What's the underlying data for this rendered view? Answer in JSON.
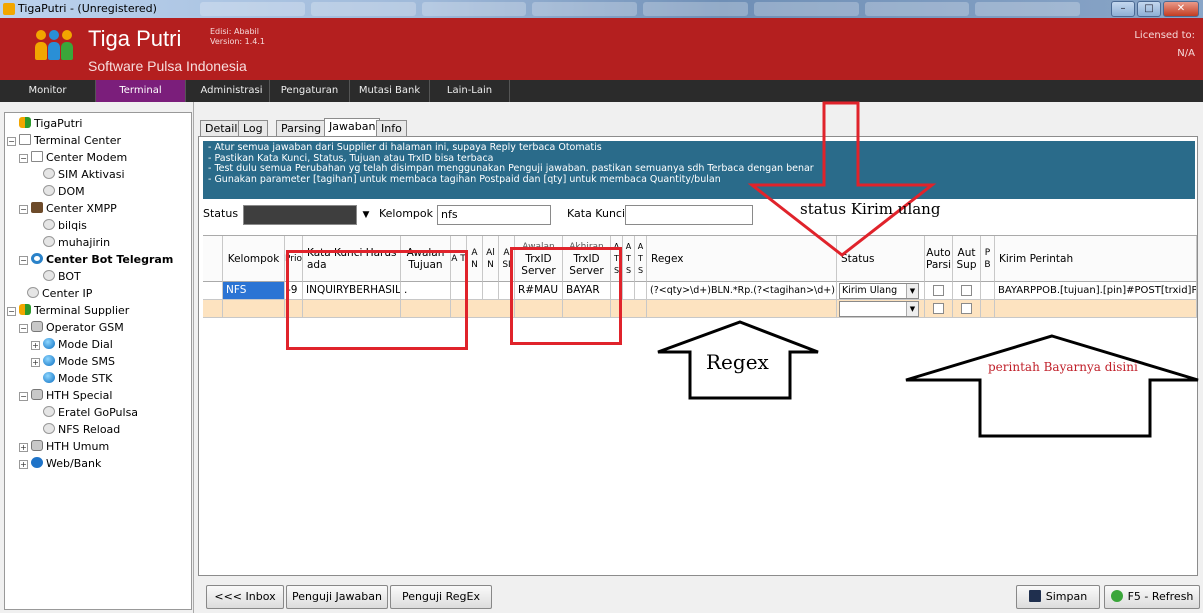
{
  "window": {
    "title": "TigaPutri - (Unregistered)"
  },
  "header": {
    "app_name": "Tiga Putri",
    "tagline": "Software Pulsa Indonesia",
    "edition": "Edisi: Ababil",
    "version": "Version: 1.4.1",
    "licensed_to": "Licensed to:",
    "license_value": "N/A"
  },
  "main_menu": [
    "Monitor",
    "Terminal",
    "Administrasi",
    "Pengaturan",
    "Mutasi Bank",
    "Lain-Lain"
  ],
  "tree": [
    "TigaPutri",
    "Terminal Center",
    "Center Modem",
    "SIM Aktivasi",
    "DOM",
    "Center XMPP",
    "bilqis",
    "muhajirin",
    "Center Bot Telegram",
    "BOT",
    "Center IP",
    "Terminal Supplier",
    "Operator GSM",
    "Mode Dial",
    "Mode SMS",
    "Mode STK",
    "HTH Special",
    "Eratel GoPulsa",
    "NFS Reload",
    "HTH Umum",
    "Web/Bank"
  ],
  "tabs": [
    "Detail",
    "Log",
    "Parsing",
    "Jawaban",
    "Info"
  ],
  "info_lines": [
    "- Atur semua jawaban dari Supplier di halaman ini, supaya Reply terbaca Otomatis",
    "- Pastikan Kata Kunci, Status, Tujuan atau TrxID bisa terbaca",
    "- Test dulu semua Perubahan yg telah disimpan menggunakan Penguji jawaban. pastikan semuanya sdh Terbaca dengan benar",
    "- Gunakan parameter [tagihan] untuk membaca tagihan Postpaid dan [qty] untuk membaca Quantity/bulan"
  ],
  "filters": {
    "status_label": "Status",
    "kelompok_label": "Kelompok",
    "kelompok_value": "nfs",
    "kata_kunci_label": "Kata Kunci"
  },
  "grid": {
    "headers": {
      "kelompok": "Kelompok",
      "prio": "Prio",
      "kata_kunci": "Kata Kunci Harus ada",
      "awalan_tujuan": "Awalan Tujuan",
      "a1": "A T",
      "a2": "A N",
      "a3": "Al N",
      "a4": "A SI",
      "trxid_awal_top": "Awalan",
      "trxid_awal": "TrxID Server",
      "trxid_akhir_top": "Akhiran",
      "trxid_akhir": "TrxID Server",
      "t1": "A T S",
      "t2": "A T S",
      "t3": "A T S",
      "regex": "Regex",
      "status": "Status",
      "auto_parsi": "Auto Parsi",
      "aut_sup": "Aut Sup",
      "pb": "P B",
      "kirim_perintah": "Kirim Perintah"
    },
    "row": {
      "kelompok": "NFS",
      "prio": "-9",
      "kata_kunci": "INQUIRYBERHASIL",
      "awalan_tujuan": ".",
      "trxid_awal": "R#MAU",
      "trxid_akhir": "BAYAR",
      "regex": "(?<qty>\\d+)BLN.*Rp.(?<tagihan>\\d+)",
      "status": "Kirim Ulang",
      "kirim_perintah": "BAYARPPOB.[tujuan].[pin]#POST[trxid]PAY"
    }
  },
  "buttons": {
    "inbox": "<<< Inbox",
    "penguji_jawaban": "Penguji Jawaban",
    "penguji_regex": "Penguji RegEx",
    "simpan": "Simpan",
    "refresh": "F5 - Refresh"
  },
  "annotations": {
    "status": "status Kirim ulang",
    "regex": "Regex",
    "perintah": "perintah Bayarnya disini"
  },
  "colors": {
    "header_red": "#b41f1f",
    "menu_active": "#7b1e7b",
    "info_blue": "#2a6b8a",
    "selected_cell": "#2b74d4",
    "annotation_red": "#e0232b"
  }
}
